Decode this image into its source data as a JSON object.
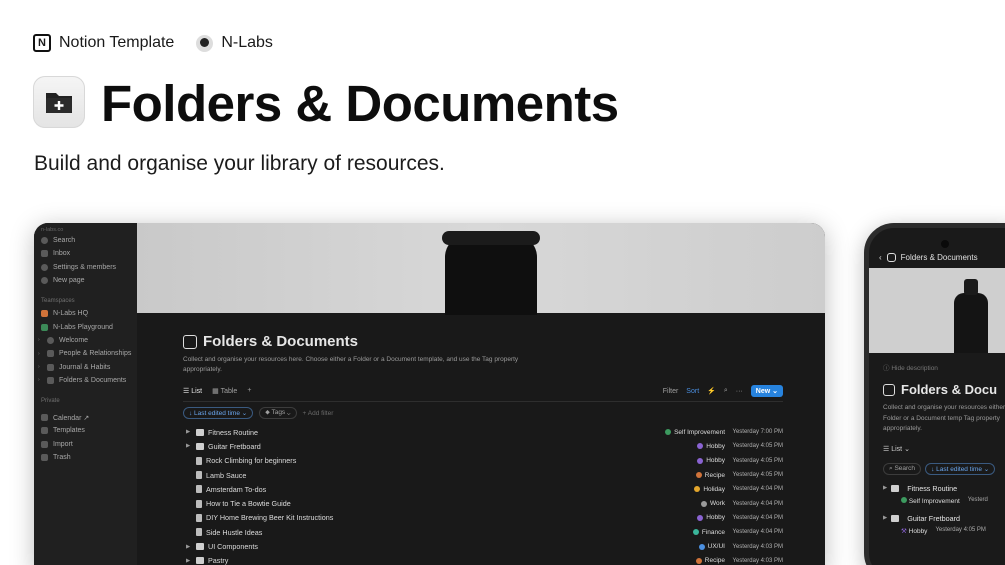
{
  "header": {
    "brand_notion": "Notion Template",
    "brand_author": "N-Labs",
    "title": "Folders & Documents",
    "subtitle": "Build and organise your library of resources."
  },
  "sidebar": {
    "workspace_hint": "n-labs.co",
    "top_items": [
      {
        "label": "Search",
        "icon": "search-icon"
      },
      {
        "label": "Inbox",
        "icon": "inbox-icon"
      },
      {
        "label": "Settings & members",
        "icon": "gear-icon"
      },
      {
        "label": "New page",
        "icon": "plus-icon"
      }
    ],
    "teamspaces_label": "Teamspaces",
    "teamspaces": [
      {
        "label": "N-Labs HQ",
        "color": "#d0733a"
      },
      {
        "label": "N-Labs Playground",
        "color": "#3c8a58"
      }
    ],
    "pages": [
      "Welcome",
      "People & Relationships",
      "Journal & Habits",
      "Folders & Documents"
    ],
    "private_label": "Private",
    "bottom_items": [
      "Calendar ↗",
      "Templates",
      "Import",
      "Trash"
    ]
  },
  "page": {
    "title": "Folders & Documents",
    "description": "Collect and organise your resources here. Choose either a Folder or a Document template, and use the Tag property appropriately.",
    "tabs": [
      "List",
      "Table",
      "+"
    ],
    "tools": {
      "filter": "Filter",
      "sort": "Sort",
      "new": "New"
    },
    "filter_chip": "↓ Last edited time ⌄",
    "tags_chip": "Tags ⌄",
    "add_filter": "+ Add filter",
    "rows": [
      {
        "name": "Fitness Routine",
        "kind": "folder",
        "tag": "Self Improvement",
        "tag_color": "#3c9a5f",
        "time": "Yesterday 7:00 PM"
      },
      {
        "name": "Guitar Fretboard",
        "kind": "folder",
        "tag": "Hobby",
        "tag_color": "#8a63d2",
        "time": "Yesterday 4:05 PM"
      },
      {
        "name": "Rock Climbing for beginners",
        "kind": "doc",
        "tag": "Hobby",
        "tag_color": "#8a63d2",
        "time": "Yesterday 4:05 PM"
      },
      {
        "name": "Lamb Sauce",
        "kind": "doc",
        "tag": "Recipe",
        "tag_color": "#d0733a",
        "time": "Yesterday 4:05 PM"
      },
      {
        "name": "Amsterdam To-dos",
        "kind": "doc",
        "tag": "Holiday",
        "tag_color": "#e3a62c",
        "time": "Yesterday 4:04 PM"
      },
      {
        "name": "How to Tie a Bowtie Guide",
        "kind": "doc",
        "tag": "Work",
        "tag_color": "#9a9a9a",
        "time": "Yesterday 4:04 PM"
      },
      {
        "name": "DIY Home Brewing Beer Kit Instructions",
        "kind": "doc",
        "tag": "Hobby",
        "tag_color": "#8a63d2",
        "time": "Yesterday 4:04 PM"
      },
      {
        "name": "Side Hustle Ideas",
        "kind": "doc",
        "tag": "Finance",
        "tag_color": "#3ab59a",
        "time": "Yesterday 4:04 PM"
      },
      {
        "name": "UI Components",
        "kind": "folder",
        "tag": "UX/UI",
        "tag_color": "#4b8fe0",
        "time": "Yesterday 4:03 PM"
      },
      {
        "name": "Pastry",
        "kind": "folder",
        "tag": "Recipe",
        "tag_color": "#d0733a",
        "time": "Yesterday 4:03 PM"
      }
    ]
  },
  "phone": {
    "nav_title": "Folders & Documents",
    "hide_desc": "Hide description",
    "title": "Folders & Docu",
    "description": "Collect and organise your resources either a Folder or a Document temp Tag property appropriately.",
    "list_label": "List ⌄",
    "search": "Search",
    "sort_chip": "↓ Last edited time ⌄",
    "rows": [
      {
        "name": "Fitness Routine",
        "tag": "Self Improvement",
        "time": "Yesterd"
      },
      {
        "name": "Guitar Fretboard",
        "tag": "Hobby",
        "time": "Yesterday 4:05 PM"
      }
    ]
  }
}
